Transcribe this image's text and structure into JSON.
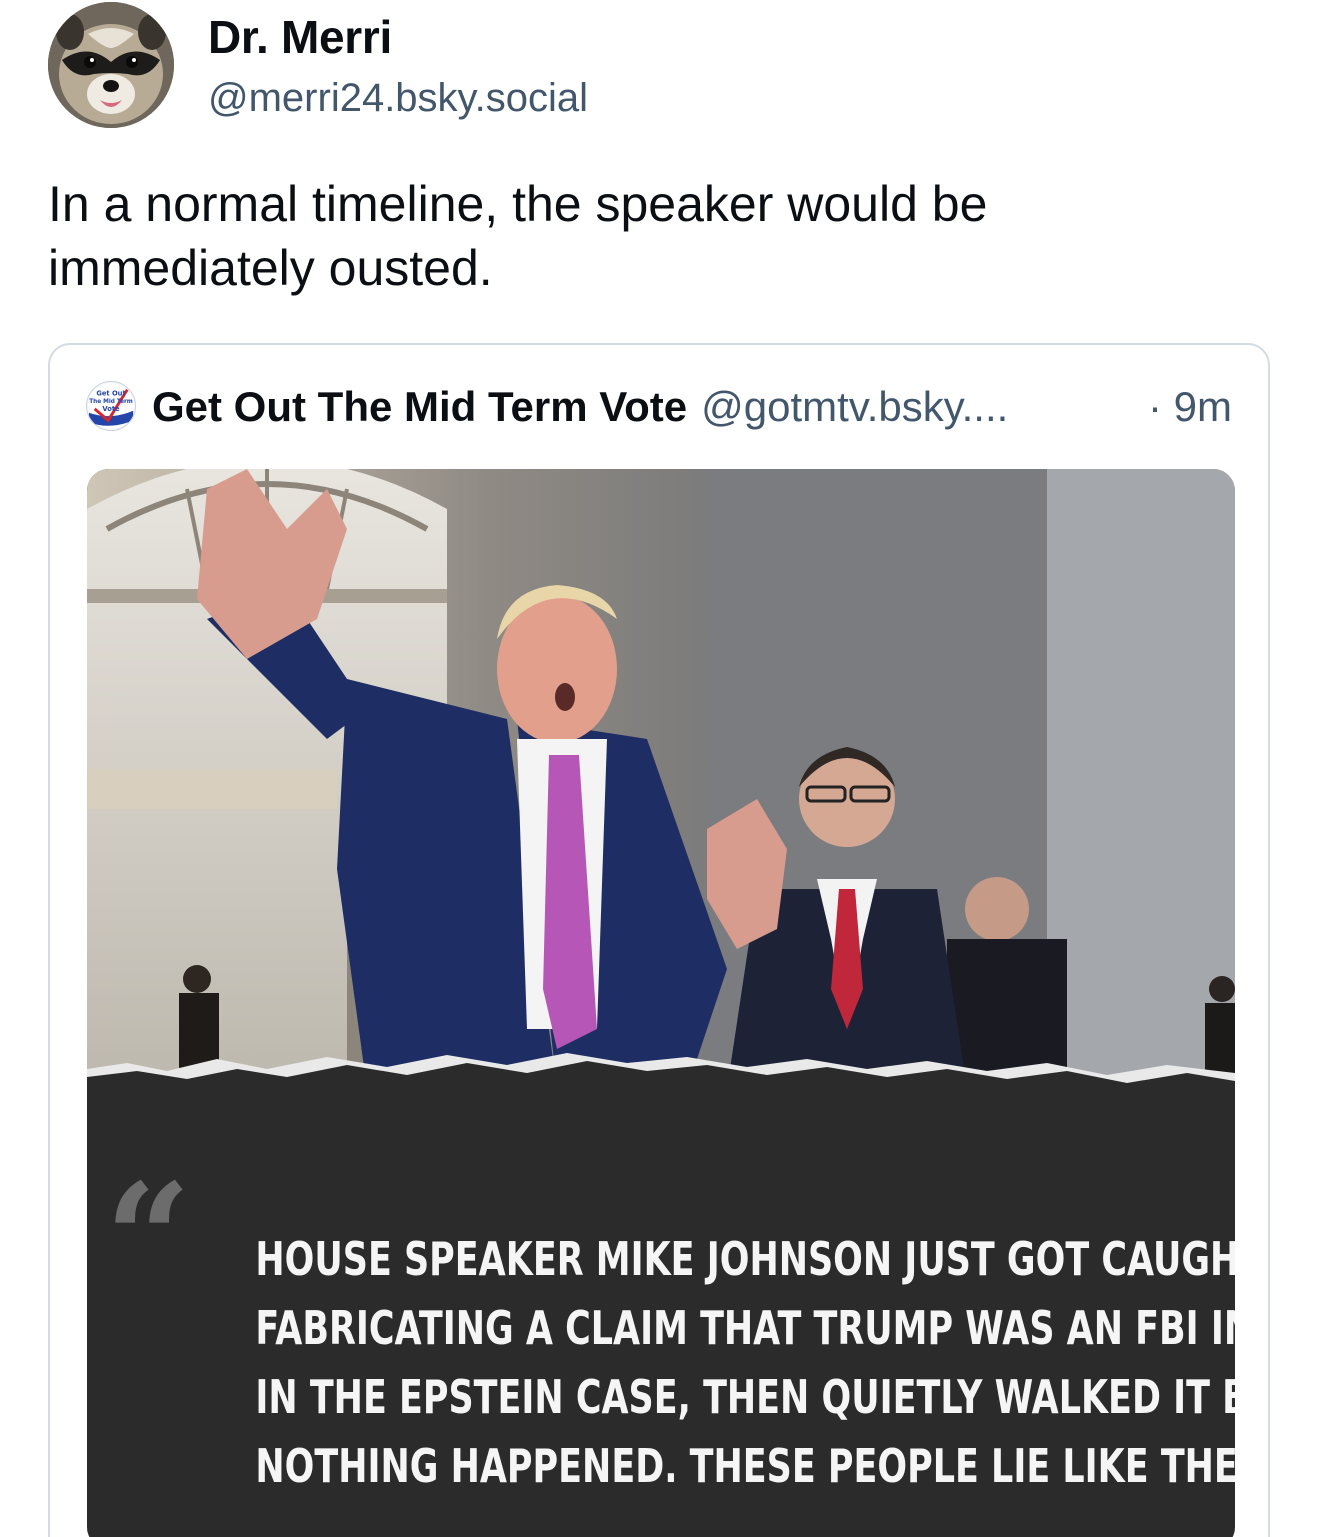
{
  "post": {
    "author_name": "Dr. Merri",
    "author_handle": "@merri24.bsky.social",
    "avatar_icon": "raccoon-avatar",
    "text_line_1": "In a normal timeline, the speaker would be",
    "text_line_2": "immediately ousted."
  },
  "quoted_post": {
    "author_name": "Get Out The Mid Term Vote",
    "author_handle": "@gotmtv.bsky....",
    "time": "· 9m",
    "avatar_logo_text": [
      "Get Out",
      "The Mid Term",
      "Vote"
    ],
    "image": {
      "quote_glyph": "“",
      "headline_lines": [
        "HOUSE SPEAKER MIKE JOHNSON JUST GOT CAUGHT",
        "FABRICATING A CLAIM THAT TRUMP WAS AN FBI INFORMANT",
        "IN THE EPSTEIN CASE, THEN QUIETLY WALKED IT BACK LIKE",
        "NOTHING HAPPENED. THESE PEOPLE LIE LIKE THEY BREATHE."
      ]
    }
  },
  "colors": {
    "text_primary": "#0b0f14",
    "text_secondary": "#42576c",
    "card_border": "#d4dbe2",
    "panel_dark": "#2b2b2b"
  }
}
